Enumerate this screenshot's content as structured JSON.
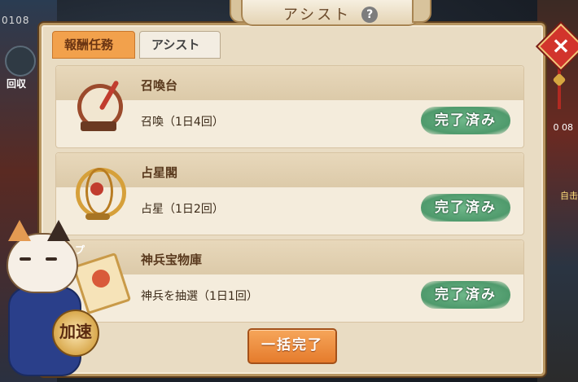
{
  "background": {
    "left_number": "0108",
    "recycle_label": "回収",
    "right_time": "0 08",
    "right_event": "自击",
    "up_label": "アップ"
  },
  "dialog": {
    "title": "アシスト",
    "help_icon": "?",
    "close_icon": "×",
    "tabs": [
      {
        "label": "報酬任務",
        "active": true
      },
      {
        "label": "アシスト",
        "active": false
      }
    ],
    "items": [
      {
        "icon": "drum-icon",
        "name": "召喚台",
        "desc": "召喚（1日4回）",
        "status": "完了済み"
      },
      {
        "icon": "astrolabe-icon",
        "name": "占星閣",
        "desc": "占星（1日2回）",
        "status": "完了済み"
      },
      {
        "icon": "treasure-scroll-icon",
        "name": "神兵宝物庫",
        "desc": "神兵を抽選（1日1回）",
        "status": "完了済み"
      }
    ],
    "bulk_button": "一括完了"
  },
  "mascot": {
    "speed_label": "加速"
  },
  "colors": {
    "panel_bg": "#e9dcc3",
    "tab_active": "#f2a14c",
    "done_badge": "#5aa677",
    "bulk_button": "#ee8d3f",
    "close_button": "#d2342c"
  }
}
